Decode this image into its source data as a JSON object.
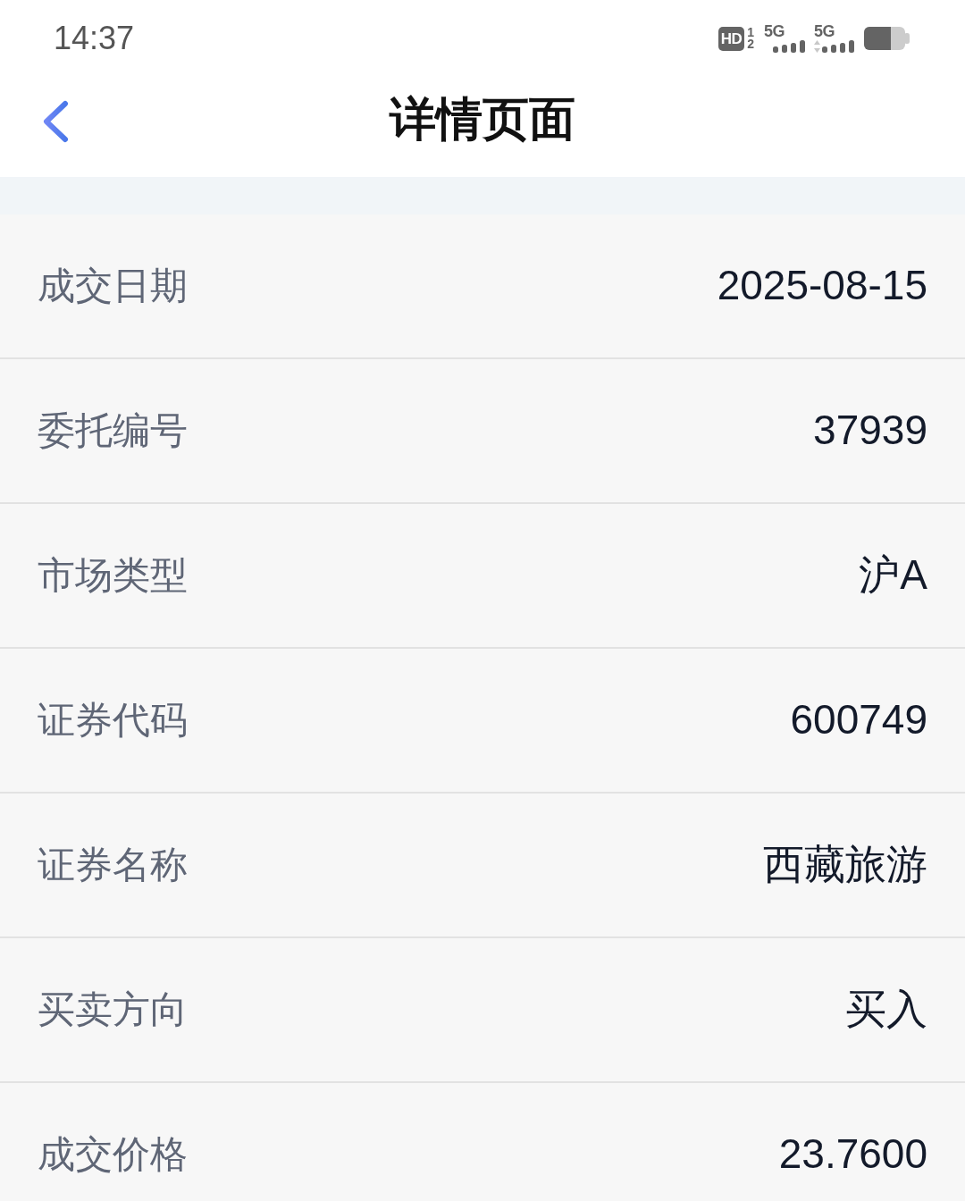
{
  "status_bar": {
    "time": "14:37",
    "hd_badge": "HD",
    "sim_slots": [
      "1",
      "2"
    ],
    "networks": [
      {
        "type": "5G",
        "data_arrows": false
      },
      {
        "type": "5G",
        "data_arrows": true
      }
    ]
  },
  "header": {
    "title": "详情页面"
  },
  "details": [
    {
      "label": "成交日期",
      "value": "2025-08-15"
    },
    {
      "label": "委托编号",
      "value": "37939"
    },
    {
      "label": "市场类型",
      "value": "沪A"
    },
    {
      "label": "证券代码",
      "value": "600749"
    },
    {
      "label": "证券名称",
      "value": "西藏旅游"
    },
    {
      "label": "买卖方向",
      "value": "买入"
    },
    {
      "label": "成交价格",
      "value": "23.7600"
    }
  ]
}
